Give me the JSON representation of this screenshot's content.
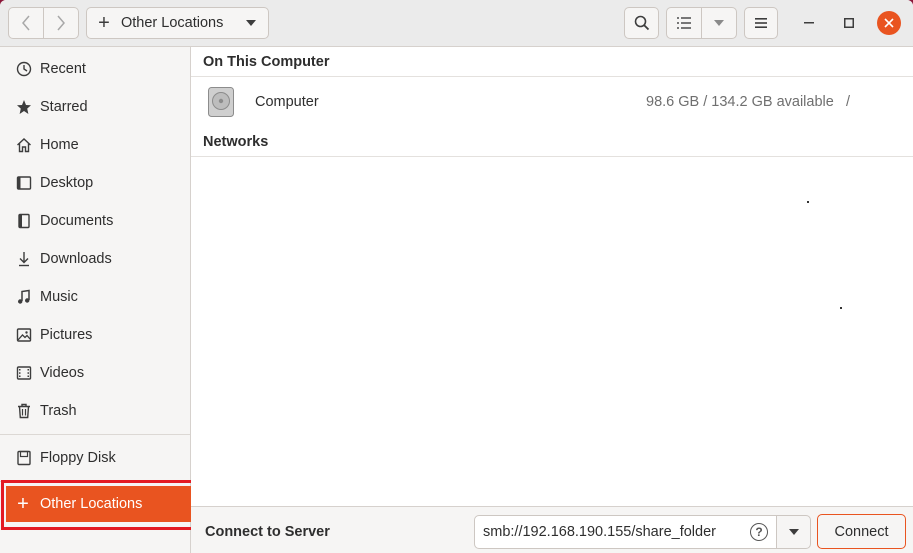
{
  "header": {
    "path_label": "Other Locations"
  },
  "sidebar": {
    "items": [
      {
        "label": "Recent",
        "icon": "clock-icon"
      },
      {
        "label": "Starred",
        "icon": "star-icon"
      },
      {
        "label": "Home",
        "icon": "home-icon"
      },
      {
        "label": "Desktop",
        "icon": "desktop-icon"
      },
      {
        "label": "Documents",
        "icon": "document-icon"
      },
      {
        "label": "Downloads",
        "icon": "download-icon"
      },
      {
        "label": "Music",
        "icon": "music-icon"
      },
      {
        "label": "Pictures",
        "icon": "picture-icon"
      },
      {
        "label": "Videos",
        "icon": "video-icon"
      },
      {
        "label": "Trash",
        "icon": "trash-icon"
      }
    ],
    "devices": [
      {
        "label": "Floppy Disk",
        "icon": "floppy-icon"
      }
    ],
    "other_locations": "Other Locations"
  },
  "main": {
    "on_this_computer": "On This Computer",
    "computer": {
      "name": "Computer",
      "available": "98.6 GB / 134.2 GB available",
      "mount": "/"
    },
    "networks": "Networks"
  },
  "bottom": {
    "connect_label": "Connect to Server",
    "server_value": "smb://192.168.190.155/share_folder",
    "connect_button": "Connect"
  },
  "colors": {
    "accent": "#e95420",
    "highlight": "#e31b23"
  }
}
